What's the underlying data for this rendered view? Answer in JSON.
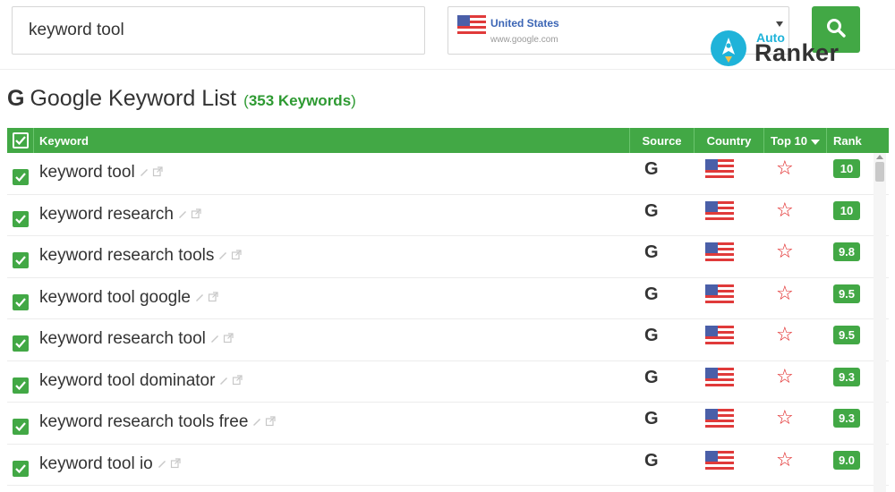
{
  "search": {
    "query": "keyword tool"
  },
  "country": {
    "name": "United States",
    "engine": "www.google.com",
    "flag_icon": "us-flag-icon"
  },
  "search_button": {
    "icon": "search-icon",
    "color": "#42a845"
  },
  "brand": {
    "small": "Auto",
    "name": "Ranker"
  },
  "heading": {
    "logo": "G",
    "title": "Google Keyword List",
    "count_open": "(",
    "count_value": "353 Keywords",
    "count_close": ")"
  },
  "table": {
    "columns": {
      "keyword": "Keyword",
      "source": "Source",
      "country": "Country",
      "top10": "Top 10",
      "rank": "Rank"
    },
    "rows": [
      {
        "keyword": "keyword tool",
        "source": "G",
        "rank": "10"
      },
      {
        "keyword": "keyword research",
        "source": "G",
        "rank": "10"
      },
      {
        "keyword": "keyword research tools",
        "source": "G",
        "rank": "9.8"
      },
      {
        "keyword": "keyword tool google",
        "source": "G",
        "rank": "9.5"
      },
      {
        "keyword": "keyword research tool",
        "source": "G",
        "rank": "9.5"
      },
      {
        "keyword": "keyword tool dominator",
        "source": "G",
        "rank": "9.3"
      },
      {
        "keyword": "keyword research tools free",
        "source": "G",
        "rank": "9.3"
      },
      {
        "keyword": "keyword tool io",
        "source": "G",
        "rank": "9.0"
      }
    ]
  },
  "colors": {
    "accent_green": "#42a845",
    "star_red": "#e02020",
    "link_blue": "#3b65b5",
    "brand_cyan": "#1fb3d9"
  }
}
